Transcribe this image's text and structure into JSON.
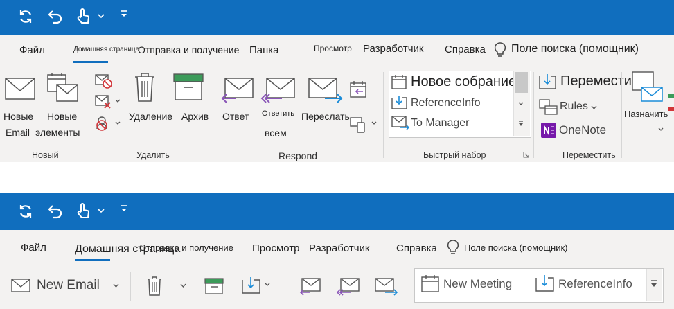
{
  "top": {
    "tabs": {
      "file": "Файл",
      "home": "Домашняя страница",
      "send_receive": "Отправка и получение",
      "folder": "Папка",
      "view": "Просмотр",
      "developer": "Разработчик",
      "help": "Справка",
      "search": "Поле поиска (помощник)"
    },
    "new_group": {
      "new_email_line1": "Новые",
      "new_email_line2": "Email",
      "new_items_line1": "Новые",
      "new_items_line2": "элементы",
      "label": "Новый"
    },
    "delete_group": {
      "delete": "Удаление",
      "archive": "Архив",
      "label": "Удалить"
    },
    "respond_group": {
      "reply": "Ответ",
      "reply_all_line1": "Ответить",
      "reply_all_line2": "всем",
      "forward": "Переслать",
      "label": "Respond"
    },
    "quick_steps": {
      "items": [
        "Новое собрание",
        "ReferenceInfo",
        "To Manager"
      ],
      "label": "Быстрый набор"
    },
    "move_group": {
      "move": "Переместить",
      "rules": "Rules",
      "onenote": "OneNote",
      "label": "Переместить"
    },
    "assign": {
      "label": "Назначить"
    }
  },
  "bottom": {
    "tabs": {
      "file": "Файл",
      "home": "Домашняя страница",
      "send_receive": "Отправка и получение",
      "view": "Просмотр",
      "developer": "Разработчик",
      "help": "Справка",
      "search": "Поле поиска (помощник)"
    },
    "new_email": "New Email",
    "quick_steps": {
      "new_meeting": "New Meeting",
      "reference_info": "ReferenceInfo"
    }
  },
  "colors": {
    "titlebar": "#106ebe",
    "ribbon": "#f3f2f1",
    "accent": "#106ebe",
    "archive_green": "#3c9b5a",
    "reply_purple": "#8a56b8",
    "forward_blue": "#1a8cd8",
    "delete_red": "#d13438",
    "onenote_purple": "#7719aa"
  }
}
